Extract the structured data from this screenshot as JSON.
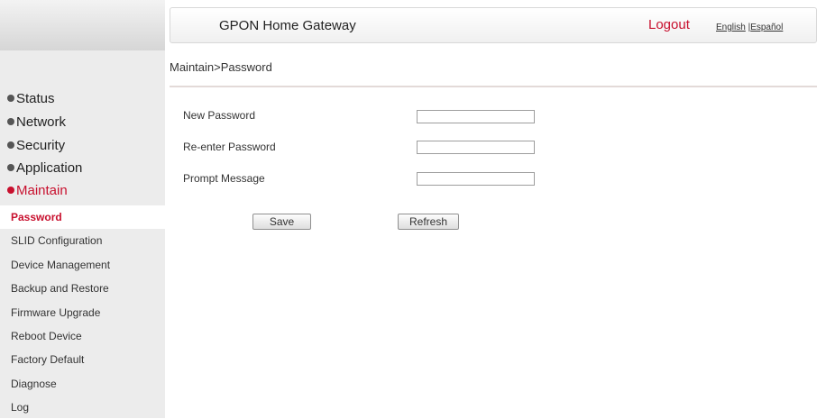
{
  "header": {
    "app_title": "GPON Home Gateway",
    "logout": "Logout",
    "lang_english": "English",
    "lang_sep": " |",
    "lang_espanol": "Español"
  },
  "breadcrumb": "Maintain>Password",
  "sidebar": {
    "categories": [
      {
        "label": "Status",
        "active": false
      },
      {
        "label": "Network",
        "active": false
      },
      {
        "label": "Security",
        "active": false
      },
      {
        "label": "Application",
        "active": false
      },
      {
        "label": "Maintain",
        "active": true
      }
    ],
    "items": [
      {
        "label": "Password",
        "active": true
      },
      {
        "label": "SLID Configuration"
      },
      {
        "label": "Device Management"
      },
      {
        "label": "Backup and Restore"
      },
      {
        "label": "Firmware Upgrade"
      },
      {
        "label": "Reboot Device"
      },
      {
        "label": "Factory Default"
      },
      {
        "label": "Diagnose"
      },
      {
        "label": "Log"
      }
    ]
  },
  "form": {
    "new_password_label": "New Password",
    "new_password_value": "",
    "reenter_label": "Re-enter Password",
    "reenter_value": "",
    "prompt_label": "Prompt Message",
    "prompt_value": "",
    "save_label": "Save",
    "refresh_label": "Refresh"
  },
  "colors": {
    "accent": "#c8102e",
    "sidebar_bg": "#ececec",
    "divider": "#e3dad8"
  }
}
